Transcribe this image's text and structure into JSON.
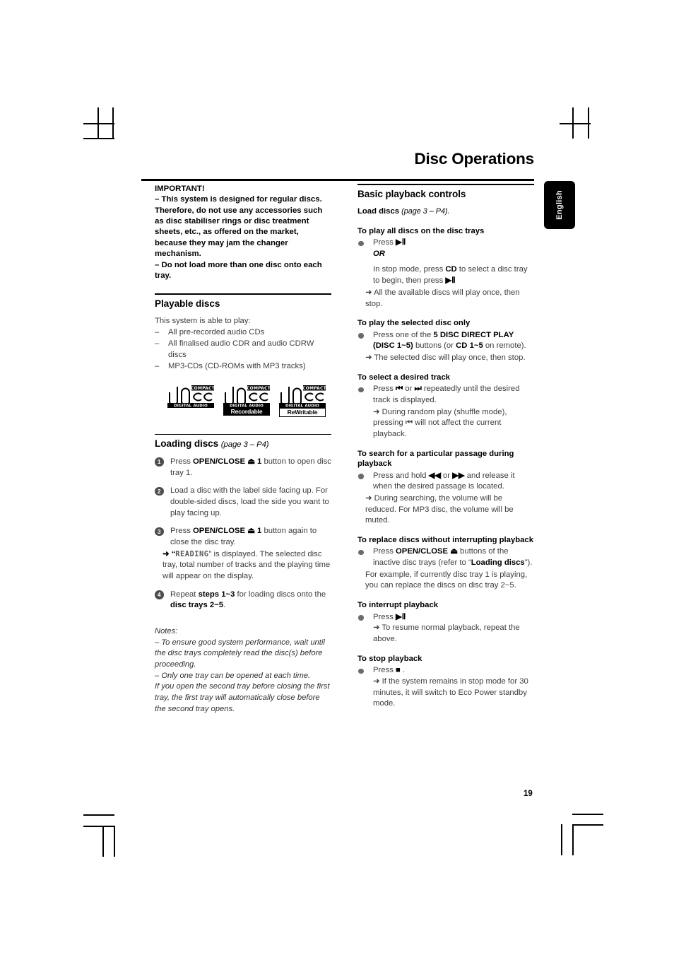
{
  "document": {
    "page_title": "Disc Operations",
    "language_tab": "English",
    "page_number": "19"
  },
  "left_column": {
    "important": {
      "heading": "IMPORTANT!",
      "lines": [
        "–  This system is designed for regular discs. Therefore, do not use any accessories such as disc stabiliser rings or disc treatment sheets, etc., as offered on the market, because they may jam the changer mechanism.",
        "–  Do not load more than one disc onto each tray."
      ]
    },
    "playable_discs": {
      "title": "Playable discs",
      "intro": "This system is able to play:",
      "items": [
        "All pre-recorded audio CDs",
        "All finalised audio CDR and audio CDRW discs",
        "MP3-CDs (CD-ROMs with MP3 tracks)"
      ],
      "logos": [
        {
          "top": "COMPACT",
          "word": "disc",
          "bottom": "DIGITAL AUDIO",
          "tag": "",
          "tag_style": "none"
        },
        {
          "top": "COMPACT",
          "word": "disc",
          "bottom": "DIGITAL AUDIO",
          "tag": "Recordable",
          "tag_style": "inverted"
        },
        {
          "top": "COMPACT",
          "word": "disc",
          "bottom": "DIGITAL AUDIO",
          "tag": "ReWritable",
          "tag_style": "normal"
        }
      ]
    },
    "loading_discs": {
      "title": "Loading discs",
      "title_paren": "(page 3 – P4)",
      "steps": [
        {
          "num": "1",
          "text_pre": "Press ",
          "bold": "OPEN/CLOSE ⏏ 1",
          "text_post": " button to open disc tray 1."
        },
        {
          "num": "2",
          "text_pre": "Load a disc with the label side facing up. For double-sided discs, load the side you want to play facing up.",
          "bold": "",
          "text_post": ""
        },
        {
          "num": "3",
          "text_pre": "Press ",
          "bold": "OPEN/CLOSE ⏏ 1",
          "text_post": " button again to close the disc tray.",
          "arrow_pre": "➜ “",
          "arrow_lcd": "READING",
          "arrow_post": "” is displayed. The selected disc tray, total number of tracks and the playing time will appear on the display."
        },
        {
          "num": "4",
          "text_pre": "Repeat ",
          "bold": "steps 1~3",
          "text_post": " for loading discs onto the ",
          "bold2": "disc trays 2~5",
          "text_post2": "."
        }
      ],
      "notes_label": "Notes:",
      "notes": [
        "–  To ensure good system performance, wait until the disc trays completely read the disc(s) before proceeding.",
        "–  Only one tray can be opened at each time.",
        "If you open the second tray before closing the first tray, the first tray will automatically close before the second tray opens."
      ]
    }
  },
  "right_column": {
    "title": "Basic playback controls",
    "load_discs_label": "Load discs",
    "load_discs_paren": "(page 3 – P4).",
    "sections": [
      {
        "heading": "To play all discs on the disc trays",
        "bullet_pre": "Press ",
        "bullet_symbol": "▶Ⅱ",
        "or_label": "OR",
        "lines": [
          "In stop mode, press CD to select a disc tray to begin, then press ▶Ⅱ"
        ],
        "arrow": "➜ All the available discs will play once, then stop."
      },
      {
        "heading": "To play the selected disc only",
        "line_pre": "Press one of the ",
        "line_bold": "5 DISC DIRECT PLAY (DISC 1~5)",
        "line_mid": " buttons (or ",
        "line_bold2": "CD 1~5",
        "line_post": " on remote).",
        "arrow": "➜ The selected disc will play once, then stop."
      },
      {
        "heading": "To select a desired track",
        "line_pre": "Press ",
        "sym1": "⏮",
        "line_mid": " or ",
        "sym2": "⏭",
        "line_post": " repeatedly until the desired track is displayed.",
        "arrow": "➜ During random play (shuffle mode), pressing ⏮ will not affect the current playback."
      },
      {
        "heading": "To search for a particular passage during playback",
        "line_pre": "Press and hold ",
        "sym1": "◀◀",
        "line_mid": " or ",
        "sym2": "▶▶",
        "line_post": " and release it when the desired passage is located.",
        "arrow": "➜ During searching, the volume will be reduced. For MP3 disc, the volume will be muted."
      },
      {
        "heading": "To replace discs without interrupting playback",
        "line_pre": "Press ",
        "line_bold": "OPEN/CLOSE ⏏",
        "line_post": " buttons of the inactive disc trays (refer to “",
        "line_bold2": "Loading discs",
        "line_post2": "”).",
        "extra": "For example, if currently disc tray 1 is playing, you can replace the discs on disc tray 2~5."
      },
      {
        "heading": "To interrupt playback",
        "line_pre": "Press ",
        "bullet_symbol": "▶Ⅱ",
        "arrow": "➜ To resume normal playback, repeat the above."
      },
      {
        "heading": "To stop playback",
        "line_pre": "Press ",
        "bullet_symbol": "■",
        "line_post": " .",
        "arrow": "➜ If the system remains in stop mode for 30 minutes, it will switch to Eco Power standby mode."
      }
    ]
  }
}
